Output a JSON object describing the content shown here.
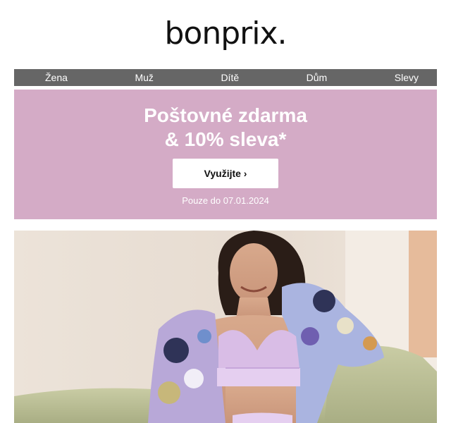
{
  "brand": {
    "logo_text": "bonprix."
  },
  "nav": {
    "items": [
      {
        "label": "Žena"
      },
      {
        "label": "Muž"
      },
      {
        "label": "Dítě"
      },
      {
        "label": "Dům"
      },
      {
        "label": "Slevy"
      }
    ]
  },
  "promo": {
    "headline_line1": "Poštovné zdarma",
    "headline_line2": "& 10% sleva*",
    "cta_label": "Využijte ›",
    "validity": "Pouze do 07.01.2024",
    "background_color": "#d4abc6"
  },
  "hero": {
    "image_subject": "woman-in-lilac-lingerie-and-floral-kimono-photo"
  }
}
